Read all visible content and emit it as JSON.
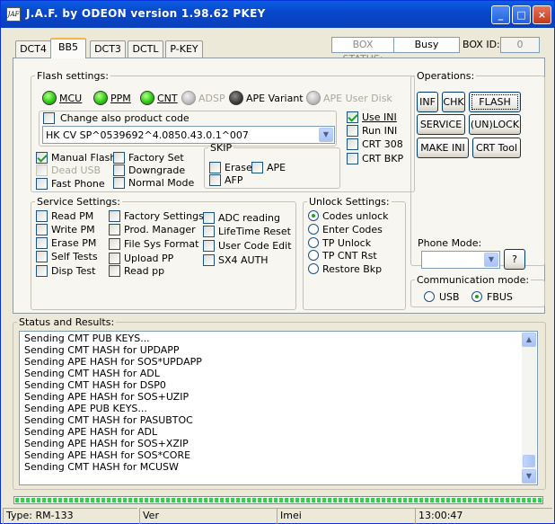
{
  "window": {
    "title": "J.A.F. by ODEON version 1.98.62 PKEY",
    "icon_text": "JAF",
    "minimize": "_",
    "maximize": "□",
    "close": "×"
  },
  "tabs": [
    {
      "label": "DCT4"
    },
    {
      "label": "BB5",
      "active": true
    },
    {
      "label": "DCT3"
    },
    {
      "label": "DCTL"
    },
    {
      "label": "P-KEY"
    }
  ],
  "box": {
    "status_label": "BOX STATUS:",
    "status_value": "Busy",
    "id_label": "BOX ID:",
    "id_value": "0"
  },
  "flash_settings": {
    "legend": "Flash settings:",
    "leds": [
      {
        "label": "MCU",
        "state": "on"
      },
      {
        "label": "PPM",
        "state": "on"
      },
      {
        "label": "CNT",
        "state": "on"
      },
      {
        "label": "ADSP",
        "state": "off"
      },
      {
        "label": "APE Variant",
        "state": "dark"
      },
      {
        "label": "APE User Disk",
        "state": "off"
      }
    ],
    "change_product_code": {
      "label": "Change also product code",
      "checked": false
    },
    "product_code": "HK CV SP^0539692^4.0850.43.0.1^007",
    "use_ini": {
      "label": "Use INI",
      "checked": true
    },
    "run_ini": {
      "label": "Run INI",
      "checked": false
    },
    "crt308": {
      "label": "CRT 308",
      "checked": false
    },
    "crt_bkp": {
      "label": "CRT BKP",
      "checked": false
    },
    "options": [
      {
        "label": "Manual Flash",
        "checked": true,
        "disabled": false
      },
      {
        "label": "Dead USB",
        "checked": false,
        "disabled": true
      },
      {
        "label": "Fast Phone",
        "checked": false,
        "disabled": false
      },
      {
        "label": "Factory Set",
        "checked": false,
        "disabled": false
      },
      {
        "label": "Downgrade",
        "checked": false,
        "disabled": false
      },
      {
        "label": "Normal Mode",
        "checked": false,
        "disabled": false
      }
    ],
    "skip": {
      "legend": "SKIP",
      "items": [
        {
          "label": "Erase",
          "checked": false
        },
        {
          "label": "APE",
          "checked": false
        },
        {
          "label": "AFP",
          "checked": false
        }
      ]
    }
  },
  "service_settings": {
    "legend": "Service Settings:",
    "items": [
      {
        "label": "Read PM"
      },
      {
        "label": "Write PM"
      },
      {
        "label": "Erase PM"
      },
      {
        "label": "Self Tests"
      },
      {
        "label": "Disp Test"
      },
      {
        "label": "Factory Settings"
      },
      {
        "label": "Prod. Manager"
      },
      {
        "label": "File Sys Format"
      },
      {
        "label": "Upload PP"
      },
      {
        "label": "Read pp"
      },
      {
        "label": "ADC reading"
      },
      {
        "label": "LifeTime Reset"
      },
      {
        "label": "User Code Edit"
      },
      {
        "label": "SX4 AUTH"
      }
    ]
  },
  "unlock_settings": {
    "legend": "Unlock Settings:",
    "items": [
      {
        "label": "Codes unlock",
        "checked": true
      },
      {
        "label": "Enter Codes",
        "checked": false
      },
      {
        "label": "TP Unlock",
        "checked": false
      },
      {
        "label": "TP CNT Rst",
        "checked": false
      },
      {
        "label": "Restore Bkp",
        "checked": false
      }
    ]
  },
  "operations": {
    "legend": "Operations:",
    "inf": "INF",
    "chk": "CHK",
    "flash": "FLASH",
    "service": "SERVICE",
    "unlock": "(UN)LOCK",
    "make_ini": "MAKE INI",
    "crt_tool": "CRT Tool",
    "phone_mode_label": "Phone Mode:",
    "phone_mode_value": "",
    "help": "?"
  },
  "comm_mode": {
    "legend": "Communication mode:",
    "usb": {
      "label": "USB",
      "checked": false
    },
    "fbus": {
      "label": "FBUS",
      "checked": true
    }
  },
  "status_results": {
    "legend": "Status and Results:",
    "lines": [
      "Sending CMT PUB KEYS...",
      "Sending CMT HASH for UPDAPP",
      "Sending APE HASH for SOS*UPDAPP",
      "Sending CMT HASH for ADL",
      "Sending CMT HASH for DSP0",
      "Sending APE HASH for SOS+UZIP",
      "Sending APE PUB KEYS...",
      "Sending CMT HASH for PASUBTOC",
      "Sending APE HASH for ADL",
      "Sending APE HASH for SOS+XZIP",
      "Sending APE HASH for SOS*CORE",
      "Sending CMT HASH for MCUSW"
    ]
  },
  "progress": {
    "percent": 100
  },
  "statusbar": {
    "type": "Type: RM-133",
    "ver": "Ver",
    "imei": "Imei",
    "time": "13:00:47"
  }
}
